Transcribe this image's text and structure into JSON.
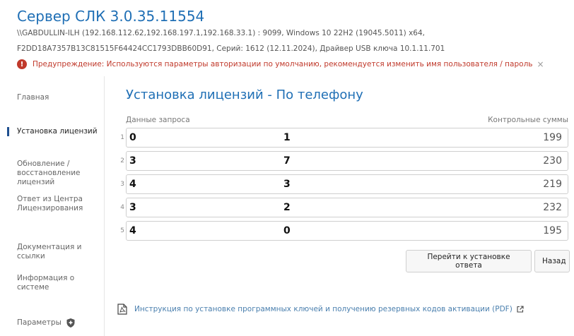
{
  "header": {
    "title": "Сервер СЛК 3.0.35.11554",
    "info_line1": "\\\\GABDULLIN-ILH (192.168.112.62,192.168.197.1,192.168.33.1) : 9099,   Windows 10 22H2 (19045.5011) x64,",
    "info_line2": "F2DD18A7357B13C81515F64424CC1793DBB60D91,   Серий: 1612 (12.11.2024),   Драйвер USB ключа 10.1.11.701",
    "warning_text": "Предупреждение: Используются параметры авторизации по умолчанию, рекомендуется изменить имя пользователя / пароль",
    "warning_close": "×"
  },
  "sidebar": {
    "items": [
      {
        "label": "Главная"
      },
      {
        "label": "Установка лицензий",
        "active": true
      },
      {
        "label": "Обновление / восстановление лицензий"
      },
      {
        "label": "Ответ из Центра Лицензирования"
      },
      {
        "label": "Документация и ссылки"
      },
      {
        "label": "Информация о системе"
      },
      {
        "label": "Параметры"
      }
    ]
  },
  "main": {
    "title": "Установка лицензий - По телефону",
    "col_request": "Данные запроса",
    "col_checksum": "Контрольные суммы",
    "rows": [
      {
        "num": "1",
        "a": "0",
        "b": "1",
        "sum": "199"
      },
      {
        "num": "2",
        "a": "3",
        "b": "7",
        "sum": "230"
      },
      {
        "num": "3",
        "a": "4",
        "b": "3",
        "sum": "219"
      },
      {
        "num": "4",
        "a": "3",
        "b": "2",
        "sum": "232"
      },
      {
        "num": "5",
        "a": "4",
        "b": "0",
        "sum": "195"
      }
    ],
    "btn_go": "Перейти к установке ответа",
    "btn_back": "Назад",
    "doc_link": "Инструкция по установке программных ключей и получению резервных кодов активации (PDF)"
  },
  "colors": {
    "accent": "#1f6fb5",
    "warning": "#c0392b",
    "link": "#4a7fae"
  }
}
